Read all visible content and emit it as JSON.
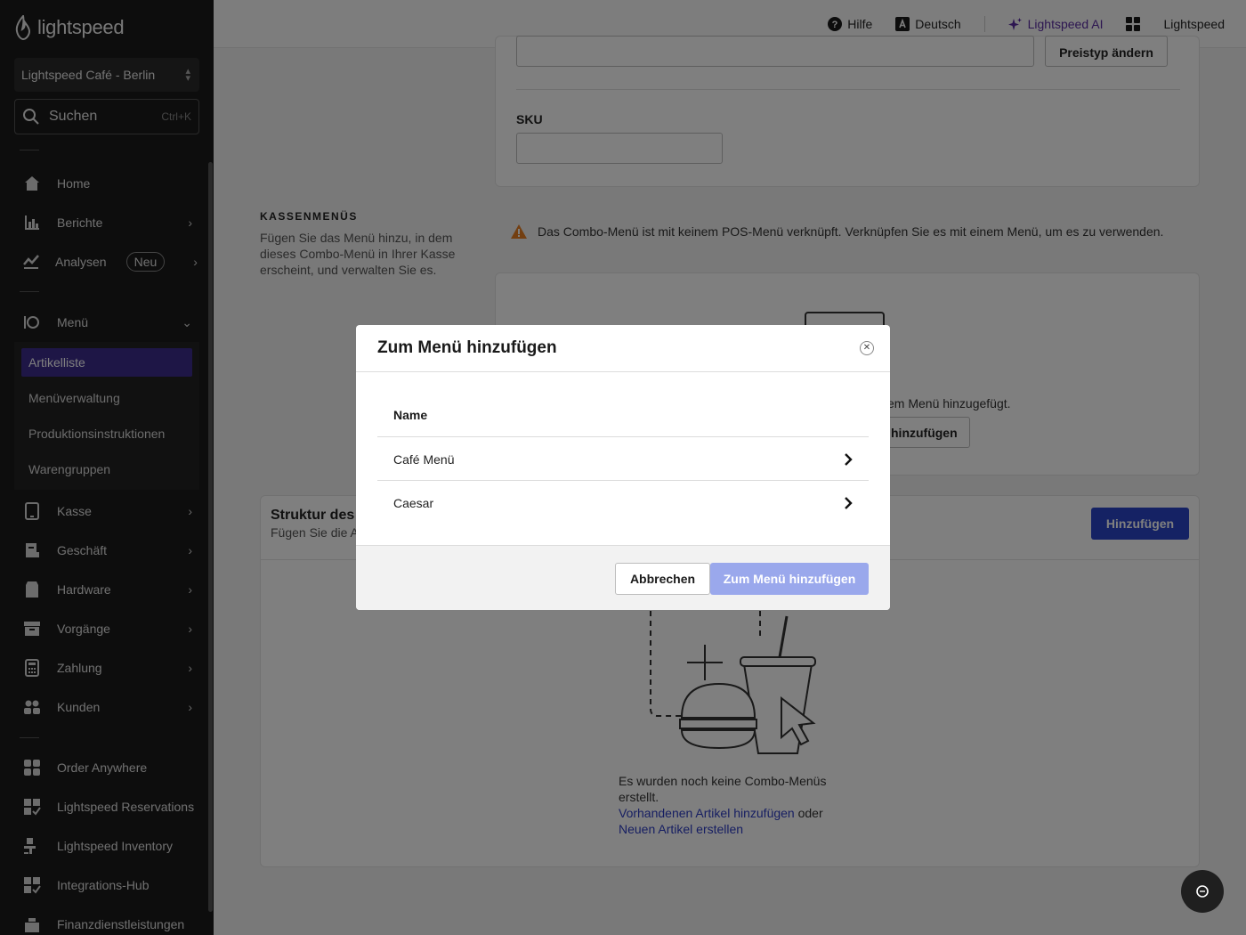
{
  "app": {
    "logo_text": "lightspeed"
  },
  "sidebar": {
    "store": "Lightspeed Café - Berlin",
    "search_label": "Suchen",
    "search_shortcut": "Ctrl+K",
    "items": [
      {
        "label": "Home",
        "icon": "home-icon"
      },
      {
        "label": "Berichte",
        "icon": "bar-chart-icon"
      },
      {
        "label": "Analysen",
        "icon": "trend-icon",
        "badge": "Neu"
      },
      {
        "label": "Menü",
        "icon": "menu-icon"
      },
      {
        "label": "Kasse",
        "icon": "tablet-icon"
      },
      {
        "label": "Geschäft",
        "icon": "receipt-icon"
      },
      {
        "label": "Hardware",
        "icon": "printer-icon"
      },
      {
        "label": "Vorgänge",
        "icon": "archive-icon"
      },
      {
        "label": "Zahlung",
        "icon": "calculator-icon"
      },
      {
        "label": "Kunden",
        "icon": "customers-icon"
      },
      {
        "label": "Order Anywhere",
        "icon": "grid-icon"
      },
      {
        "label": "Lightspeed Reservations",
        "icon": "reservations-icon"
      },
      {
        "label": "Lightspeed Inventory",
        "icon": "inventory-icon"
      },
      {
        "label": "Integrations-Hub",
        "icon": "integrations-icon"
      },
      {
        "label": "Finanzdienstleistungen",
        "icon": "finance-icon"
      }
    ],
    "submenu": [
      "Artikelliste",
      "Menüverwaltung",
      "Produktionsinstruktionen",
      "Warengruppen"
    ]
  },
  "topbar": {
    "help": "Hilfe",
    "language": "Deutsch",
    "ai": "Lightspeed AI",
    "account": "Lightspeed"
  },
  "main": {
    "price_type_button": "Preistyp ändern",
    "sku_label": "SKU",
    "section_title": "KASSENMENÜS",
    "section_desc": "Fügen Sie das Menü hinzu, in dem dieses Combo-Menü in Ihrer Kasse erscheint, und verwalten Sie es.",
    "warning": "Das Combo-Menü ist mit keinem POS-Menü verknüpft. Verknüpfen Sie es mit einem Menü, um es zu verwenden.",
    "pos_empty_text": "em Menü hinzugefügt.",
    "pos_add_button": "hinzufügen",
    "structure_title": "Struktur des C",
    "structure_desc": "Fügen Sie die Ar",
    "structure_add": "Hinzufügen",
    "empty_text": "Es wurden noch keine Combo-Menüs erstellt.",
    "link_existing": "Vorhandenen Artikel hinzufügen",
    "or": "oder",
    "link_new": "Neuen Artikel erstellen"
  },
  "modal": {
    "title": "Zum Menü hinzufügen",
    "column_name": "Name",
    "rows": [
      "Café Menü",
      "Caesar"
    ],
    "cancel": "Abbrechen",
    "confirm": "Zum Menü hinzufügen"
  },
  "colors": {
    "accent": "#3c2c8c",
    "primary": "#2a45c8",
    "primary_disabled": "#9aa8ec",
    "ai": "#5b2da3",
    "warning": "#e67e22"
  }
}
